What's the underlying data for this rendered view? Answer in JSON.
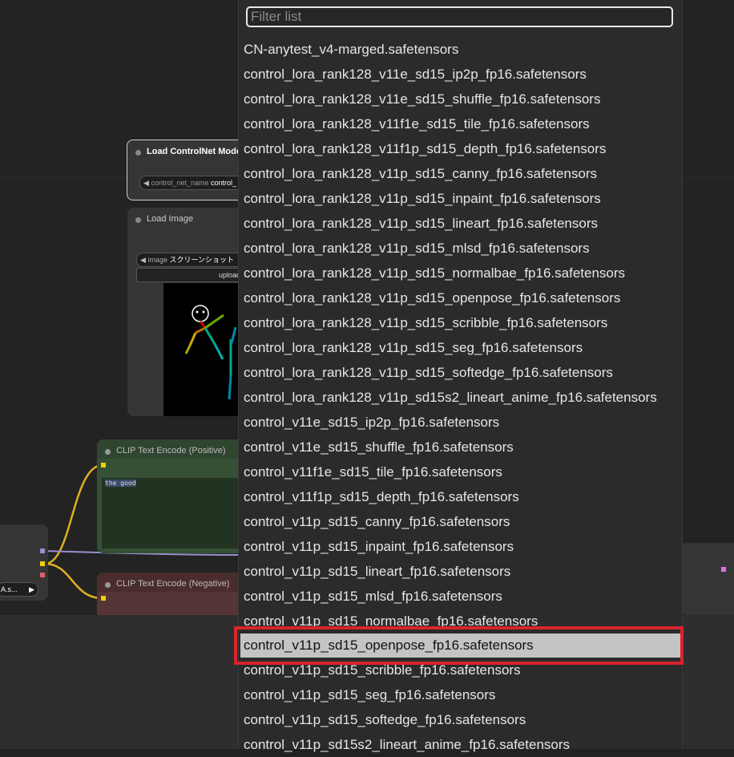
{
  "nodes": {
    "load_controlnet": {
      "title": "Load ControlNet Model",
      "widget_label": "control_net_name",
      "widget_value": "control_"
    },
    "load_image": {
      "title": "Load Image",
      "image_label": "image",
      "image_value": "スクリーンショット",
      "upload_label": "upload"
    },
    "clip_positive": {
      "title": "CLIP Text Encode (Positive)",
      "text": "the good"
    },
    "clip_negative": {
      "title": "CLIP Text Encode (Negative)"
    },
    "left_node": {
      "widget_value": "A.s..."
    }
  },
  "dropdown": {
    "placeholder": "Filter list",
    "selected_index": 24,
    "items": [
      "CN-anytest_v4-marged.safetensors",
      "control_lora_rank128_v11e_sd15_ip2p_fp16.safetensors",
      "control_lora_rank128_v11e_sd15_shuffle_fp16.safetensors",
      "control_lora_rank128_v11f1e_sd15_tile_fp16.safetensors",
      "control_lora_rank128_v11f1p_sd15_depth_fp16.safetensors",
      "control_lora_rank128_v11p_sd15_canny_fp16.safetensors",
      "control_lora_rank128_v11p_sd15_inpaint_fp16.safetensors",
      "control_lora_rank128_v11p_sd15_lineart_fp16.safetensors",
      "control_lora_rank128_v11p_sd15_mlsd_fp16.safetensors",
      "control_lora_rank128_v11p_sd15_normalbae_fp16.safetensors",
      "control_lora_rank128_v11p_sd15_openpose_fp16.safetensors",
      "control_lora_rank128_v11p_sd15_scribble_fp16.safetensors",
      "control_lora_rank128_v11p_sd15_seg_fp16.safetensors",
      "control_lora_rank128_v11p_sd15_softedge_fp16.safetensors",
      "control_lora_rank128_v11p_sd15s2_lineart_anime_fp16.safetensors",
      "control_v11e_sd15_ip2p_fp16.safetensors",
      "control_v11e_sd15_shuffle_fp16.safetensors",
      "control_v11f1e_sd15_tile_fp16.safetensors",
      "control_v11f1p_sd15_depth_fp16.safetensors",
      "control_v11p_sd15_canny_fp16.safetensors",
      "control_v11p_sd15_inpaint_fp16.safetensors",
      "control_v11p_sd15_lineart_fp16.safetensors",
      "control_v11p_sd15_mlsd_fp16.safetensors",
      "control_v11p_sd15_normalbae_fp16.safetensors",
      "control_v11p_sd15_openpose_fp16.safetensors",
      "control_v11p_sd15_scribble_fp16.safetensors",
      "control_v11p_sd15_seg_fp16.safetensors",
      "control_v11p_sd15_softedge_fp16.safetensors",
      "control_v11p_sd15s2_lineart_anime_fp16.safetensors"
    ]
  },
  "colors": {
    "highlight_border": "#d9232d",
    "selected_bg": "#c4c4c4",
    "wire_yellow": "#e0b020",
    "wire_purple": "#9a8fd0"
  }
}
